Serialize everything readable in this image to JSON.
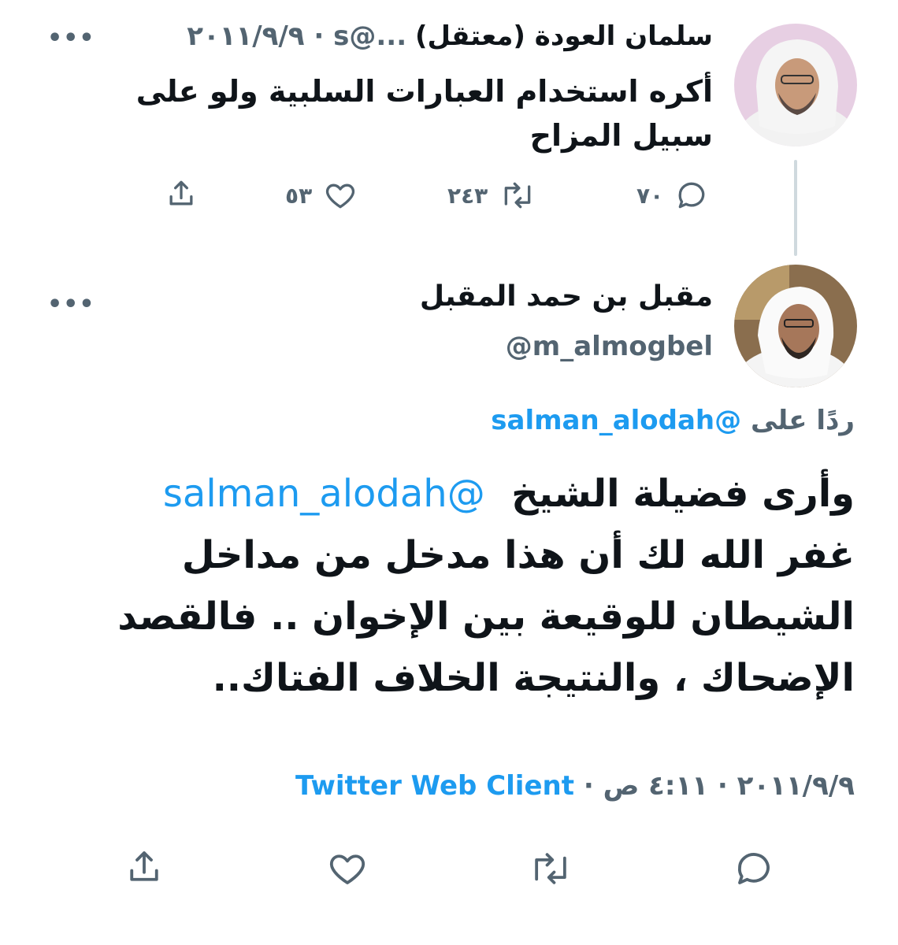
{
  "tweet1": {
    "display_name": "سلمان العودة (معتقل)",
    "meta": "...@s · ٢٠١١/٩/٩",
    "text_line1": "أكره استخدام العبارات السلبية ولو على",
    "text_line2": "سبيل المزاح",
    "replies": "٧٠",
    "retweets": "٢٤٣",
    "likes": "٥٣"
  },
  "tweet2": {
    "display_name": "مقبل بن حمد المقبل",
    "handle": "@m_almogbel",
    "replying_prefix": "ردًا على",
    "replying_to": "@salman_alodah",
    "mention": "@salman_alodah",
    "text_line1": "وأرى فضيلة الشيخ",
    "text_line2": "غفر الله لك أن هذا مدخل من مداخل",
    "text_line3": "الشيطان للوقيعة بين الإخوان .. فالقصد",
    "text_line4": "الإضحاك ، والنتيجة الخلاف الفتاك..",
    "date": "٢٠١١/٩/٩",
    "time": "٤:١١ ص",
    "separator": "·",
    "client": "Twitter Web Client"
  },
  "colors": {
    "accent": "#1d9bf0",
    "muted": "#536471",
    "text": "#0f1419"
  },
  "icons": [
    "more-icon",
    "reply-icon",
    "retweet-icon",
    "like-icon",
    "share-icon"
  ]
}
